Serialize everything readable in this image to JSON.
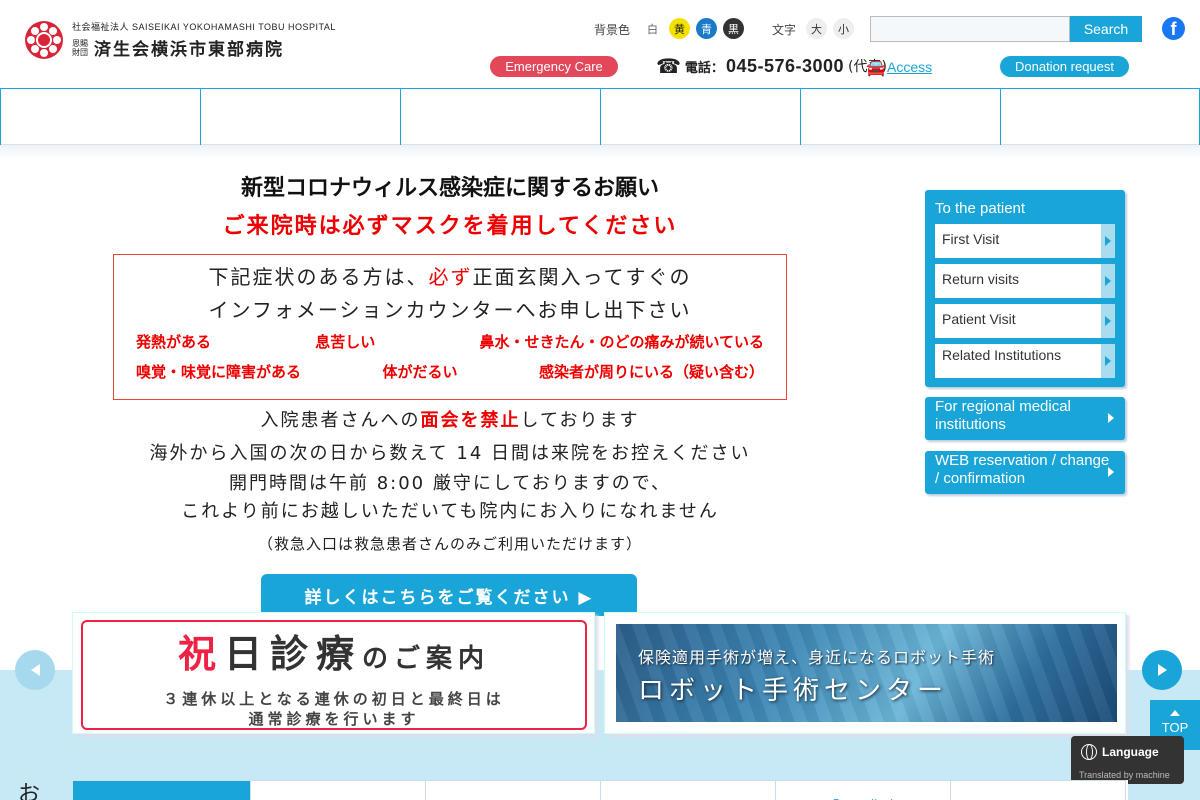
{
  "header": {
    "logo_line1": "社会福祉法人 SAISEIKAI YOKOHAMASHI TOBU HOSPITAL",
    "logo_small": "恩賜財団",
    "logo_name": "済生会横浜市東部病院",
    "bgcolor_label": "背景色",
    "bg_white": "白",
    "bg_yellow": "黄",
    "bg_blue": "青",
    "bg_black": "黒",
    "font_label": "文字",
    "font_large": "大",
    "font_small": "小",
    "search_placeholder": "",
    "search_label": "Search",
    "facebook_letter": "f",
    "emergency_label": "Emergency Care",
    "phone_label": "電話：",
    "phone_number": "045-576-3000",
    "phone_paren": "(代表)",
    "access_label": "Access",
    "donation_label": "Donation request"
  },
  "notice": {
    "title": "新型コロナウィルス感染症に関するお願い",
    "mask": "ご来院時は必ずマスクを着用してください",
    "box_line1_pre": "下記症状のある方は、",
    "box_line1_red": "必ず",
    "box_line1_post": "正面玄関入ってすぐの",
    "box_line2": "インフォメーションカウンターへお申し出下さい",
    "symptoms_row1": [
      "発熱がある",
      "息苦しい",
      "鼻水・せきたん・のどの痛みが続いている"
    ],
    "symptoms_row2": [
      "嗅覚・味覚に障害がある",
      "体がだるい",
      "感染者が周りにいる（疑い含む）"
    ],
    "visit_pre": "入院患者さんへの",
    "visit_red": "面会を禁止",
    "visit_post": "しております",
    "overseas": "海外から入国の次の日から数えて 14 日間は来院をお控えください",
    "gate1": "開門時間は午前 8:00 厳守にしておりますので、",
    "gate2": "これより前にお越しいただいても院内にお入りになれません",
    "emergency_note": "（救急入口は救急患者さんのみご利用いただけます）",
    "detail_button": "詳しくはこちらをご覧ください ▶"
  },
  "sidebar": {
    "patient_title": "To the patient",
    "patient_items": [
      "First Visit",
      "Return visits",
      "Patient Visit",
      "Related Institutions"
    ],
    "regional": "For regional medical institutions",
    "web_reservation": "WEB reservation / change / confirmation"
  },
  "banners": {
    "holiday_char": "祝",
    "holiday_rest": "日診療",
    "holiday_small": "のご案内",
    "holiday_sub1": "３連休以上となる連休の初日と最終日は",
    "holiday_sub2": "通常診療を行います",
    "robot_sub": "保険適用手術が増え、身近になるロボット手術",
    "robot_title": "ロボット手術センター"
  },
  "widgets": {
    "top_label": "TOP",
    "language_label": "Language",
    "translated_note": "Translated by machine"
  },
  "bottom": {
    "o_char": "お",
    "tabs": [
      "",
      "",
      "",
      "",
      "Formedical",
      "",
      ""
    ]
  },
  "colors": {
    "accent": "#1aa5d8",
    "emergency": "#e2475a",
    "red_text": "#ee0000"
  }
}
